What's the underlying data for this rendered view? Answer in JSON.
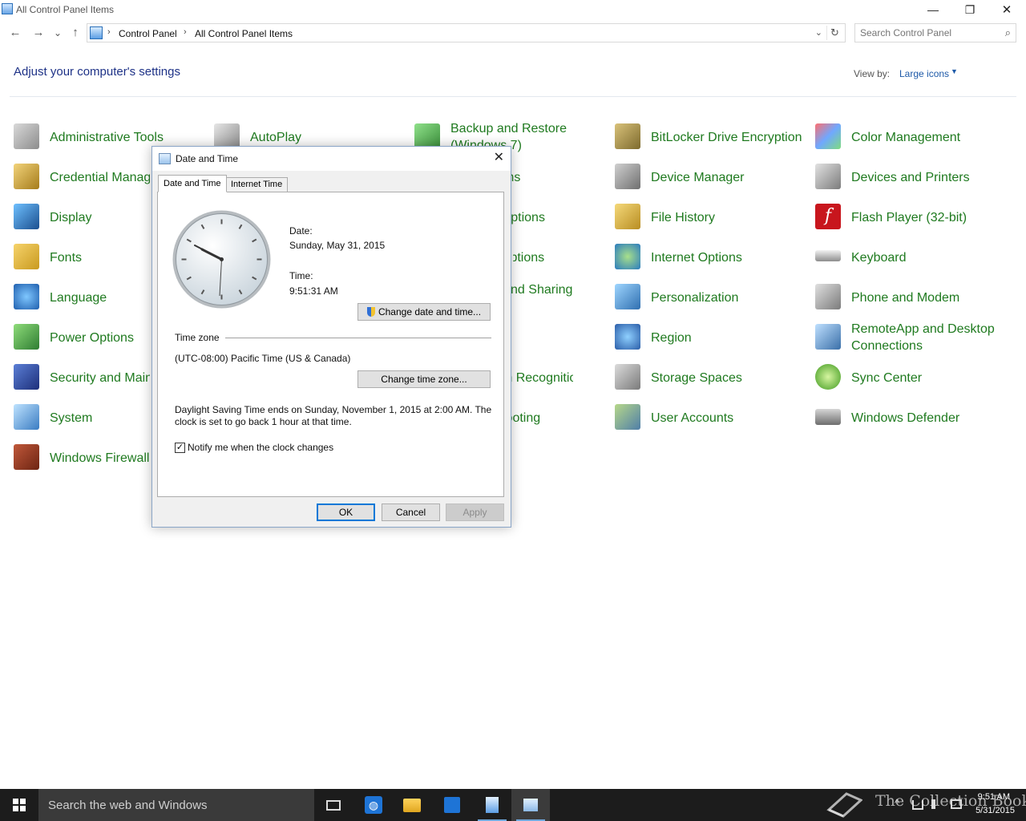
{
  "window": {
    "title": "All Control Panel Items",
    "controls": {
      "minimize": "—",
      "maximize": "❐",
      "close": "✕"
    }
  },
  "nav": {
    "back": "←",
    "forward": "→",
    "recent": "⌄",
    "up": "↑",
    "breadcrumb": [
      "Control Panel",
      "All Control Panel Items"
    ],
    "separator": "›",
    "dropdown": "⌄",
    "refresh": "↻",
    "search_placeholder": "Search Control Panel",
    "search_icon": "⌕"
  },
  "header": {
    "heading": "Adjust your computer's settings",
    "view_by_label": "View by:",
    "view_by_value": "Large icons",
    "caret": "▼"
  },
  "items": {
    "col1": [
      "Administrative Tools",
      "Credential Manager",
      "Display",
      "Fonts",
      "Language",
      "Power Options",
      "Security and Maintenance",
      "System",
      "Windows Firewall"
    ],
    "col2": [
      "AutoPlay"
    ],
    "col3": [
      "Backup and Restore",
      "(Windows 7)",
      "Programs",
      "Folder Options",
      "Options",
      "Network and Sharing",
      "Speech Recognition",
      "Troubleshooting"
    ],
    "col4": [
      "BitLocker Drive Encryption",
      "Device Manager",
      "File History",
      "Internet Options",
      "Personalization",
      "Region",
      "Storage Spaces",
      "User Accounts"
    ],
    "col5": [
      "Color Management",
      "Devices and Printers",
      "Flash Player (32-bit)",
      "Keyboard",
      "Phone and Modem",
      "RemoteApp and Desktop",
      "Connections",
      "Sync Center",
      "Windows Defender"
    ]
  },
  "dialog": {
    "title": "Date and Time",
    "close": "✕",
    "tabs": [
      "Date and Time",
      "Internet Time"
    ],
    "date_label": "Date:",
    "date_value": "Sunday, May 31, 2015",
    "time_label": "Time:",
    "time_value": "9:51:31 AM",
    "change_datetime_button": "Change date and time...",
    "timezone_label": "Time zone",
    "timezone_value": "(UTC-08:00) Pacific Time (US & Canada)",
    "change_timezone_button": "Change time zone...",
    "dst_line1": "Daylight Saving Time ends on Sunday, November 1, 2015 at 2:00 AM. The",
    "dst_line2": "clock is set to go back 1 hour at that time.",
    "notify_label": "Notify me when the clock changes",
    "notify_checked": true,
    "checkmark": "✓",
    "ok": "OK",
    "cancel": "Cancel",
    "apply": "Apply"
  },
  "taskbar": {
    "search_text": "Search the web and Windows",
    "clock_time": "9:51 AM",
    "clock_date": "5/31/2015",
    "watermark": "The Collection Book",
    "tray_arrow": "^"
  }
}
